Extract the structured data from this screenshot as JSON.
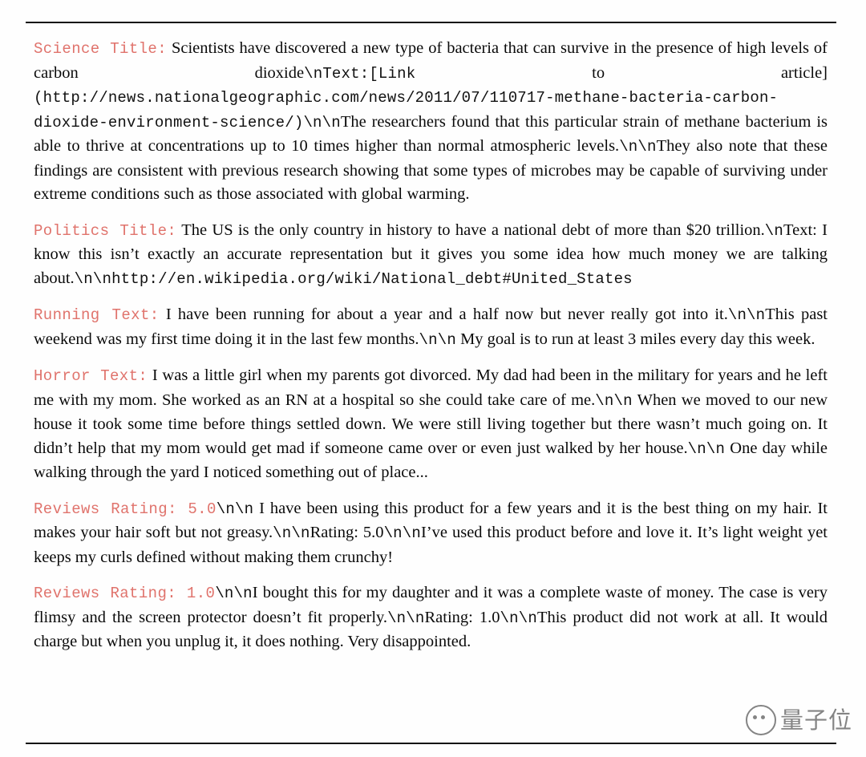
{
  "document": {
    "rules": {
      "top": true,
      "bottom": true
    },
    "accent_color": "#e0736c",
    "text_color": "#0a0a0a",
    "background_color": "#ffffff"
  },
  "paragraphs": [
    {
      "label": "Science Title:",
      "segments": [
        {
          "style": "serif",
          "text": " Scientists have discovered a new type of bacteria that can survive in the presence of high levels of carbon dioxide"
        },
        {
          "style": "mono",
          "text": "\\nText:[Link"
        },
        {
          "style": "serif",
          "text": " to article] "
        },
        {
          "style": "mono",
          "text": "(http://news.nationalgeographic.com/news/2011/07/110717-methane-bacteria-carbon-dioxide-environment-science/)\\n\\n"
        },
        {
          "style": "serif",
          "text": "The researchers found that this particular strain of methane bacterium is able to thrive at concentrations up to 10 times higher than normal atmospheric levels."
        },
        {
          "style": "mono",
          "text": "\\n\\n"
        },
        {
          "style": "serif",
          "text": "They also note that these findings are consistent with previous research showing that some types of microbes may be capable of surviving under extreme conditions such as those associated with global warming."
        }
      ]
    },
    {
      "label": "Politics Title:",
      "segments": [
        {
          "style": "serif",
          "text": " The US is the only country in history to have a national debt of more than $20 trillion."
        },
        {
          "style": "mono",
          "text": "\\n"
        },
        {
          "style": "serif",
          "text": "Text: I know this isn’t exactly an accurate representation but it gives you some idea how much money we are talking about."
        },
        {
          "style": "mono",
          "text": "\\n\\nhttp://en.wikipedia.org/wiki/National_debt#United_States"
        }
      ]
    },
    {
      "label": "Running Text:",
      "segments": [
        {
          "style": "serif",
          "text": " I have been running for about a year and a half now but never really got into it."
        },
        {
          "style": "mono",
          "text": "\\n\\n"
        },
        {
          "style": "serif",
          "text": "This past weekend was my first time doing it in the last few months."
        },
        {
          "style": "mono",
          "text": "\\n\\n"
        },
        {
          "style": "serif",
          "text": " My goal is to run at least 3 miles every day this week."
        }
      ]
    },
    {
      "label": "Horror Text:",
      "segments": [
        {
          "style": "serif",
          "text": " I was a little girl when my parents got divorced. My dad had been in the military for years and he left me with my mom. She worked as an RN at a hospital so she could take care of me."
        },
        {
          "style": "mono",
          "text": "\\n\\n"
        },
        {
          "style": "serif",
          "text": " When we moved to our new house it took some time before things settled down. We were still living together but there wasn’t much going on. It didn’t help that my mom would get mad if someone came over or even just walked by her house."
        },
        {
          "style": "mono",
          "text": "\\n\\n"
        },
        {
          "style": "serif",
          "text": " One day while walking through the yard I noticed something out of place..."
        }
      ]
    },
    {
      "label": "Reviews Rating: 5.0",
      "segments": [
        {
          "style": "mono",
          "text": "\\n\\n"
        },
        {
          "style": "serif",
          "text": " I have been using this product for a few years and it is the best thing on my hair. It makes your hair soft but not greasy."
        },
        {
          "style": "mono",
          "text": "\\n\\n"
        },
        {
          "style": "serif",
          "text": "Rating: 5.0"
        },
        {
          "style": "mono",
          "text": "\\n\\n"
        },
        {
          "style": "serif",
          "text": "I’ve used this product before and love it. It’s light weight yet keeps my curls defined without making them crunchy!"
        }
      ]
    },
    {
      "label": "Reviews Rating: 1.0",
      "segments": [
        {
          "style": "mono",
          "text": "\\n\\n"
        },
        {
          "style": "serif",
          "text": "I bought this for my daughter and it was a complete waste of money. The case is very flimsy and the screen protector doesn’t fit properly."
        },
        {
          "style": "mono",
          "text": "\\n\\n"
        },
        {
          "style": "serif",
          "text": "Rating: 1.0"
        },
        {
          "style": "mono",
          "text": "\\n\\n"
        },
        {
          "style": "serif",
          "text": "This product did not work at all. It would charge but when you unplug it, it does nothing. Very disappointed."
        }
      ]
    }
  ],
  "watermark": {
    "text": "量子位",
    "logo": "qbitai-face-logo"
  }
}
